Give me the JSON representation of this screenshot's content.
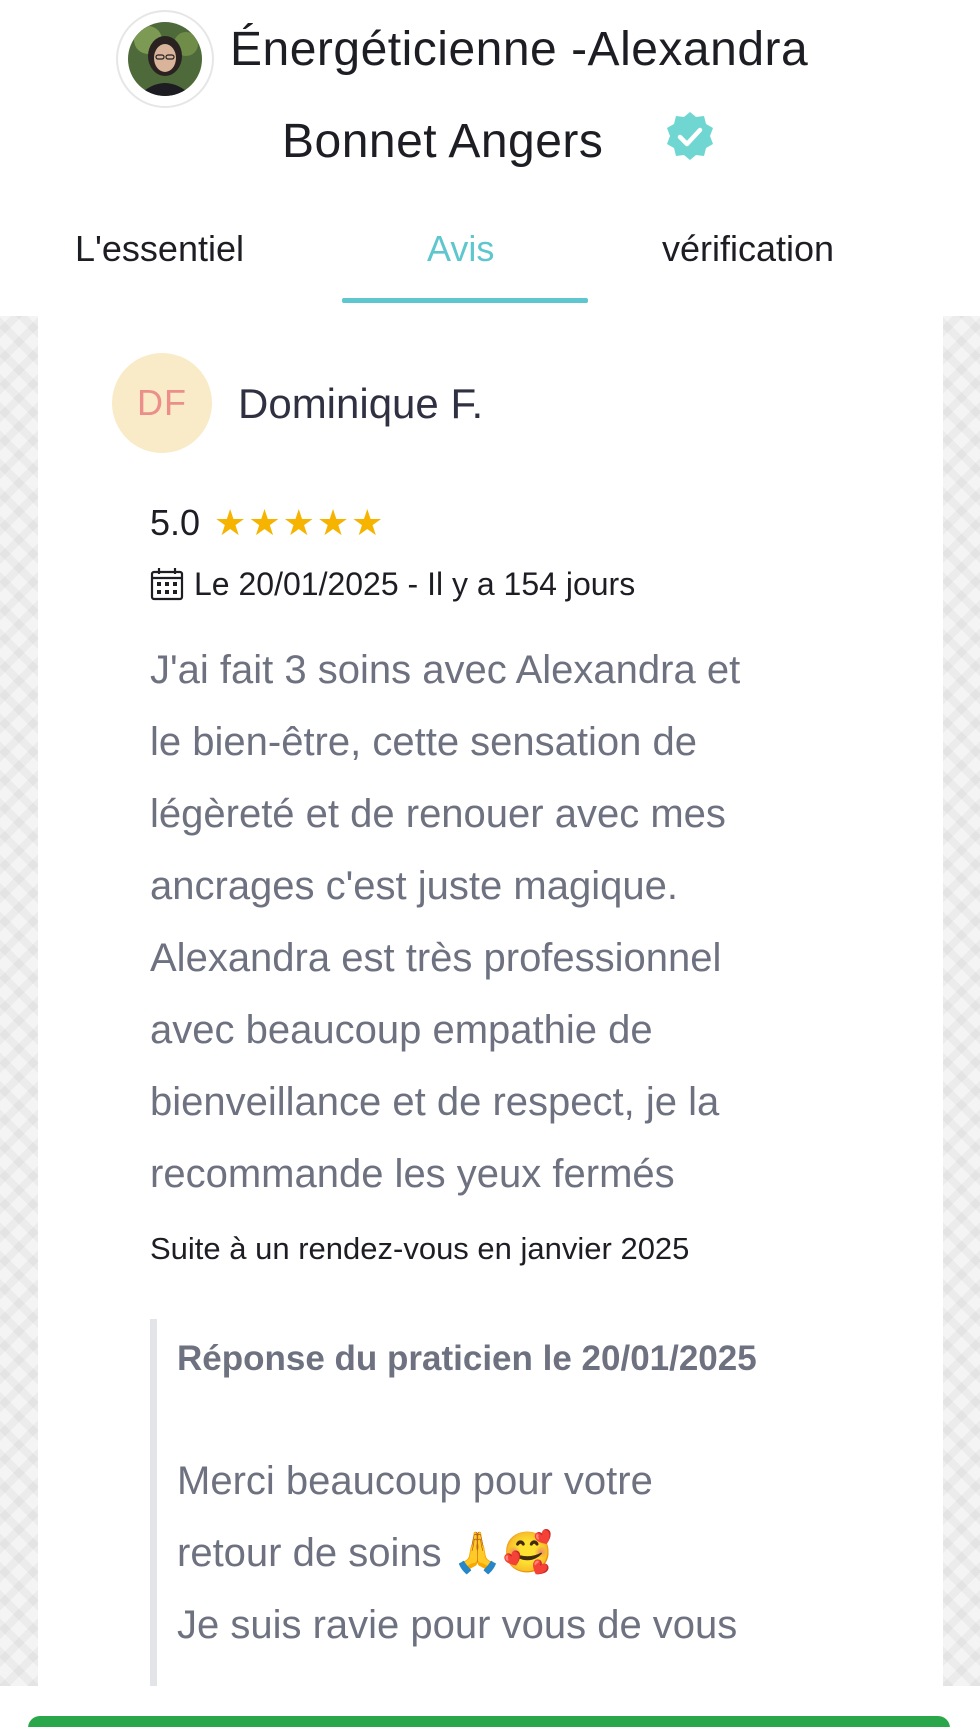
{
  "header": {
    "title_line1": "Énergéticienne -Alexandra",
    "title_line2": "Bonnet Angers",
    "verified_icon": "verified-badge-icon",
    "avatar_icon": "practitioner-photo"
  },
  "tabs": [
    {
      "label": "L'essentiel",
      "active": false
    },
    {
      "label": "Avis",
      "active": true
    },
    {
      "label": "vérification",
      "active": false
    }
  ],
  "colors": {
    "accent": "#5ec6cf",
    "star": "#f6b300",
    "initials_bg": "#f9ebc7",
    "initials_text": "#ec8f8b",
    "bottom_bar": "#29a74a"
  },
  "review": {
    "initials": "DF",
    "reviewer_name": "Dominique F.",
    "rating": "5.0",
    "stars": 5,
    "date_text": "Le 20/01/2025 - Il y a 154 jours",
    "text_lines": [
      "J'ai fait 3 soins avec Alexandra et",
      "le bien-être, cette sensation de",
      "légèreté et de renouer avec mes",
      "ancrages c'est juste magique.",
      "Alexandra est très professionnel",
      "avec beaucoup  empathie  de",
      "bienveillance et de respect, je la",
      "recommande les yeux fermés"
    ],
    "appointment": "Suite à un rendez-vous en janvier 2025"
  },
  "response": {
    "title": "Réponse du praticien le 20/01/2025",
    "text_lines": [
      "Merci beaucoup pour votre",
      "retour de soins 🙏🥰",
      "Je suis ravie pour vous de vous"
    ]
  }
}
